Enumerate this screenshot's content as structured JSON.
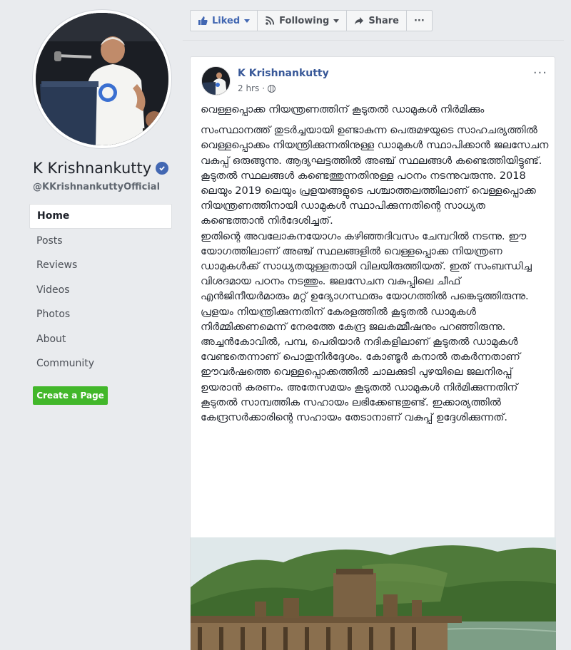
{
  "profile": {
    "name": "K Krishnankutty",
    "handle": "@KKrishnankuttyOfficial"
  },
  "nav": {
    "items": [
      {
        "label": "Home",
        "active": true
      },
      {
        "label": "Posts"
      },
      {
        "label": "Reviews"
      },
      {
        "label": "Videos"
      },
      {
        "label": "Photos"
      },
      {
        "label": "About"
      },
      {
        "label": "Community"
      }
    ]
  },
  "create_page_label": "Create a Page",
  "actions": {
    "liked": "Liked",
    "following": "Following",
    "share": "Share",
    "more": "···"
  },
  "post": {
    "author": "K Krishnankutty",
    "time": "2 hrs",
    "menu": "···",
    "title": "വെള്ളപ്പൊക്ക നിയന്ത്രണത്തിന് കൂടുതൽ ഡാമുകൾ നിർമിക്കും",
    "body": "സംസ്ഥാനത്ത് തുടർച്ചയായി ഉണ്ടാകുന്ന പെരുമഴയുടെ സാഹചര്യത്തിൽ വെള്ളപ്പൊക്കം നിയന്ത്രിക്കുന്നതിനുള്ള ഡാമുകൾ സ്ഥാപിക്കാൻ ജലസേചന വകുപ്പ് ഒരുങ്ങുന്നു. ആദ്യഘട്ടത്തിൽ അഞ്ച് സ്ഥലങ്ങൾ കണ്ടെത്തിയിട്ടുണ്ട്. കൂടുതൽ സ്ഥലങ്ങൾ കണ്ടെത്തുന്നതിനുള്ള പഠനം നടന്നുവരുന്നു. 2018 ലെയും 2019 ലെയും പ്രളയങ്ങളുടെ പശ്ചാത്തലത്തിലാണ് വെള്ളപ്പൊക്ക നിയന്ത്രണത്തിനായി ഡാമുകൾ സ്ഥാപിക്കുന്നതിന്റെ സാധ്യത കണ്ടെത്താൻ നിർദേശിച്ചത്.\nഇതിന്റെ അവലോകനയോഗം കഴിഞ്ഞദിവസം ചേമ്പറിൽ നടന്നു. ഈ യോഗത്തിലാണ് അഞ്ച് സ്ഥലങ്ങളിൽ വെള്ളപ്പൊക്ക നിയന്ത്രണ ഡാമുകൾക്ക് സാധ്യതയുള്ളതായി വിലയിരുത്തിയത്. ഇത് സംബന്ധിച്ച വിശദമായ പഠനം നടത്തും. ജലസേചന വകുപ്പിലെ ചീഫ് എൻജിനീയർമാരും മറ്റ് ഉദ്യോഗസ്ഥരും യോഗത്തിൽ പങ്കെടുത്തിരുന്നു.\nപ്രളയം നിയന്ത്രിക്കുന്നതിന് കേരളത്തിൽ കൂടുതൽ ഡാമുകൾ നിർമ്മിക്കണമെന്ന് നേരത്തേ കേന്ദ്ര ജലകമ്മീഷനും പറഞ്ഞിരുന്നു. അച്ചൻകോവിൽ, പമ്പ, പെരിയാർ നദികളിലാണ് കൂടുതൽ ഡാമുകൾ വേണ്ടതെന്നാണ് പൊതുനിർദ്ദേശം. കോണ്ടൂർ കനാൽ തകർന്നതാണ് ഈവർഷത്തെ വെള്ളപ്പൊക്കത്തിൽ ചാലക്കുടി പുഴയിലെ ജലനിരപ്പ് ഉയരാൻ കരണം. അതേസമയം കൂടുതൽ ഡാമുകൾ നിർമിക്കുന്നതിന് കൂടുതൽ സാമ്പത്തിക സഹായം ലഭിക്കേണ്ടതുണ്ട്. ഇക്കാര്യത്തിൽ കേന്ദ്രസർക്കാരിന്റെ സഹായം തേടാനാണ് വകുപ്പ് ഉദ്ദേശിക്കുന്നത്."
  }
}
